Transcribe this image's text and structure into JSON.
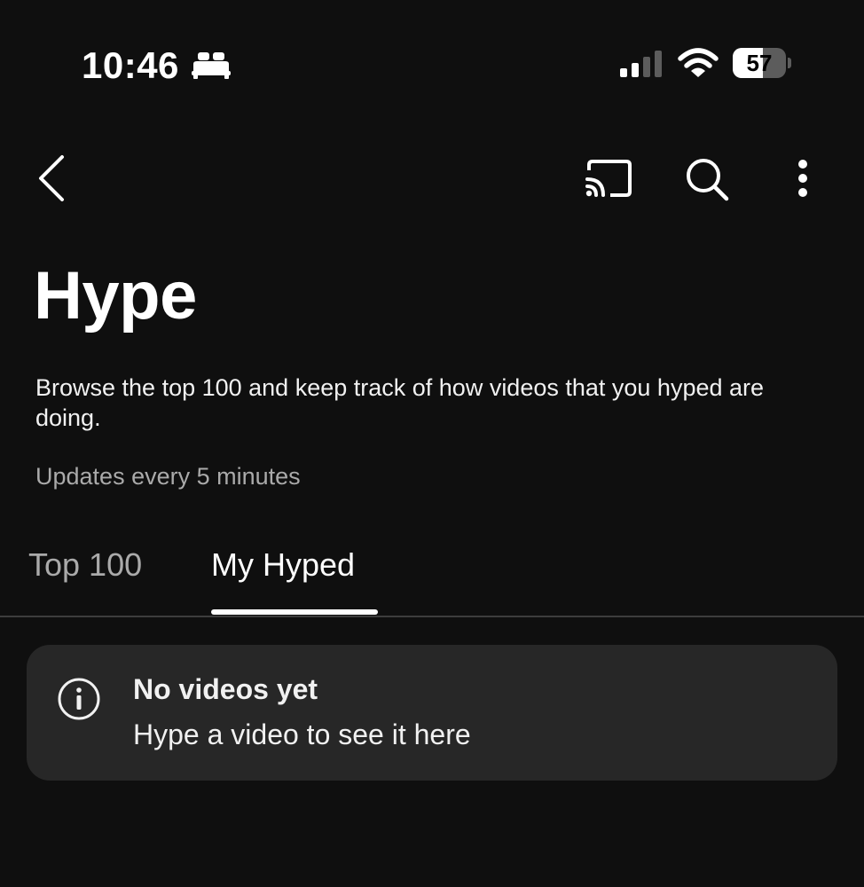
{
  "status_bar": {
    "time": "10:46",
    "sleep_focus_icon": "bed-icon",
    "signal_icon": "cellular-signal-icon",
    "wifi_icon": "wifi-icon",
    "battery_level": "57",
    "battery_fraction": 0.57
  },
  "app_bar": {
    "back_icon": "chevron-left-icon",
    "cast_icon": "cast-icon",
    "search_icon": "search-icon",
    "more_icon": "more-vertical-icon"
  },
  "header": {
    "title": "Hype",
    "description": "Browse the top 100 and keep track of how videos that you hyped are doing.",
    "update_note": "Updates every 5 minutes"
  },
  "tabs": [
    {
      "label": "Top 100",
      "selected": false
    },
    {
      "label": "My Hyped",
      "selected": true
    }
  ],
  "empty_state": {
    "icon": "info-icon",
    "title": "No videos yet",
    "message": "Hype a video to see it here"
  },
  "colors": {
    "background": "#0f0f0f",
    "card": "#272727",
    "text_primary": "#f1f1f1",
    "text_secondary": "#aaaaaa",
    "divider": "#3d3d3d"
  }
}
